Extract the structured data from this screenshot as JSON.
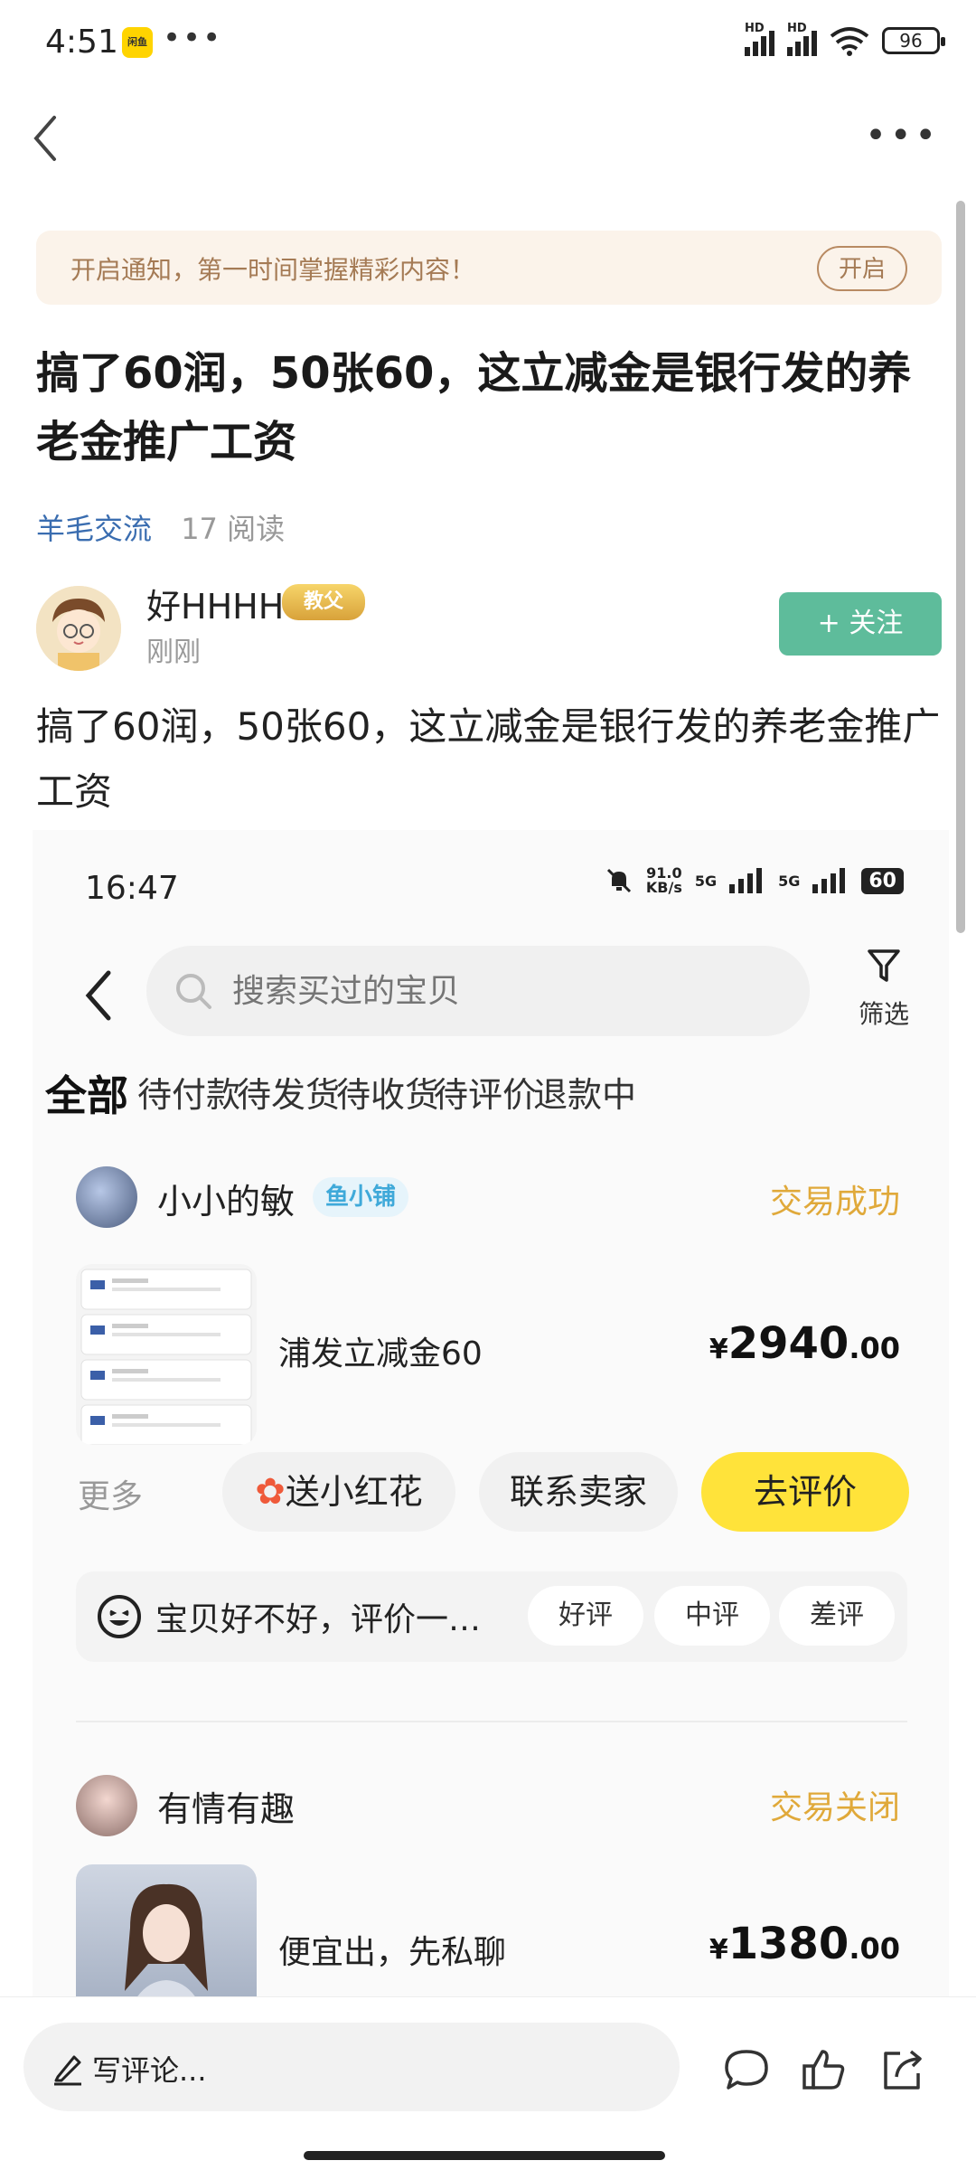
{
  "status_bar": {
    "time": "4:51",
    "app_icon_text": "闲鱼",
    "more_dots": "•••",
    "sim1_label": "HD",
    "sim2_label": "HD",
    "battery": "96"
  },
  "nav": {
    "more": "•••"
  },
  "notify": {
    "text": "开启通知，第一时间掌握精彩内容！",
    "button": "开启"
  },
  "post": {
    "title": "搞了60润，50张60，这立减金是银行发的养老金推广工资",
    "category": "羊毛交流",
    "reads": "17 阅读",
    "author": {
      "name": "好HHHH",
      "badge": "教父",
      "time": "刚刚"
    },
    "follow_label": "+ 关注",
    "body": "搞了60润，50张60，这立减金是银行发的养老金推广工资"
  },
  "screenshot": {
    "time": "16:47",
    "net_speed": "91.0",
    "net_unit": "KB/s",
    "sig1": "5G",
    "sig2": "5G",
    "battery": "60",
    "search_placeholder": "搜索买过的宝贝",
    "filter_label": "筛选",
    "tabs": [
      "全部",
      "待付款",
      "待发货",
      "待收货",
      "待评价",
      "退款中"
    ],
    "orders": [
      {
        "seller": "小小的敏",
        "tag": "鱼小铺",
        "status": "交易成功",
        "title": "浦发立减金60",
        "price_symbol": "¥",
        "price_int": "2940",
        "price_dec": ".00",
        "more": "更多",
        "actions": [
          "送小红花",
          "联系卖家",
          "去评价"
        ],
        "rate_prompt": "宝贝好不好，评价一…",
        "rate_options": [
          "好评",
          "中评",
          "差评"
        ]
      },
      {
        "seller": "有情有趣",
        "status": "交易关闭",
        "title": "便宜出，先私聊",
        "price_symbol": "¥",
        "price_int": "1380",
        "price_dec": ".00"
      }
    ]
  },
  "bottom_bar": {
    "comment_placeholder": "写评论..."
  },
  "colors": {
    "accent_green": "#5ebc9b",
    "status_yellow": "#e0a93a",
    "button_yellow": "#ffe33a",
    "link_blue": "#3a6db0"
  }
}
